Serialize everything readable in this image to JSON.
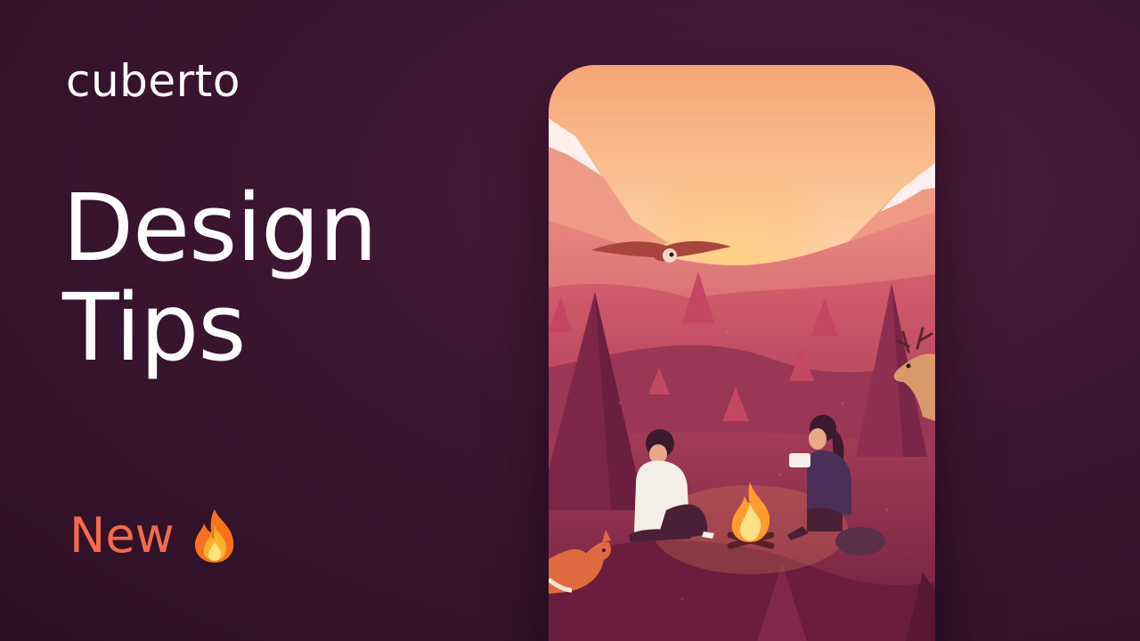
{
  "brand": {
    "name": "cuberto"
  },
  "headline": {
    "line1": "Design",
    "line2": "Tips"
  },
  "badge": {
    "label": "New",
    "icon": "fire-icon",
    "color": "#f26b4b"
  },
  "colors": {
    "background": "#3c1532",
    "sky_top": "#f8a677",
    "forest": "#7a2346",
    "fire": "#ffb23a"
  }
}
